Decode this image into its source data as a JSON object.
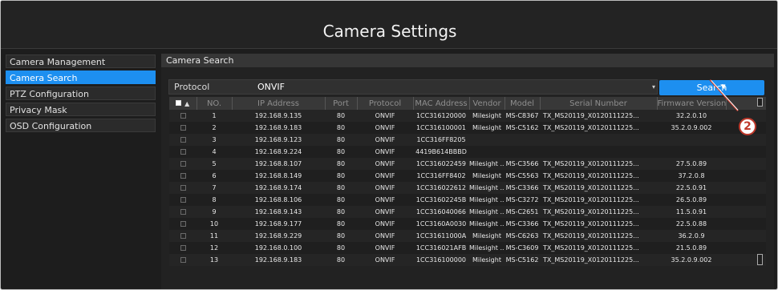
{
  "window": {
    "title": "Camera Settings"
  },
  "sidebar": {
    "items": [
      {
        "label": "Camera Management",
        "active": false
      },
      {
        "label": "Camera Search",
        "active": true
      },
      {
        "label": "PTZ Configuration",
        "active": false
      },
      {
        "label": "Privacy Mask",
        "active": false
      },
      {
        "label": "OSD Configuration",
        "active": false
      }
    ]
  },
  "main": {
    "header": "Camera Search",
    "protocol": {
      "label": "Protocol",
      "value": "ONVIF"
    },
    "search_label": "Search",
    "table": {
      "columns": [
        "NO.",
        "IP Address",
        "Port",
        "Protocol",
        "MAC Address",
        "Vendor",
        "Model",
        "Serial Number",
        "Firmware Version"
      ],
      "rows": [
        [
          "1",
          "192.168.9.135",
          "80",
          "ONVIF",
          "1CC316120000",
          "Milesight",
          "MS-C8367",
          "TX_MS20119_X0120111225...",
          "32.2.0.10"
        ],
        [
          "2",
          "192.168.9.183",
          "80",
          "ONVIF",
          "1CC316100001",
          "Milesight",
          "MS-C5162",
          "TX_MS20119_X0120111225...",
          "35.2.0.9.002"
        ],
        [
          "3",
          "192.168.9.123",
          "80",
          "ONVIF",
          "1CC316FF8205",
          "",
          "",
          "",
          ""
        ],
        [
          "4",
          "192.168.9.224",
          "80",
          "ONVIF",
          "4419B614BBBD",
          "",
          "",
          "",
          ""
        ],
        [
          "5",
          "192.168.8.107",
          "80",
          "ONVIF",
          "1CC316022459",
          "Milesight ...",
          "MS-C3566",
          "TX_MS20119_X0120111225...",
          "27.5.0.89"
        ],
        [
          "6",
          "192.168.8.149",
          "80",
          "ONVIF",
          "1CC316FF8402",
          "Milesight",
          "MS-C5563",
          "TX_MS20119_X0120111225...",
          "37.2.0.8"
        ],
        [
          "7",
          "192.168.9.174",
          "80",
          "ONVIF",
          "1CC316022612",
          "Milesight ...",
          "MS-C3366",
          "TX_MS20119_X0120111225...",
          "22.5.0.91"
        ],
        [
          "8",
          "192.168.8.106",
          "80",
          "ONVIF",
          "1CC31602245B",
          "Milesight ...",
          "MS-C3272",
          "TX_MS20119_X0120111225...",
          "26.5.0.89"
        ],
        [
          "9",
          "192.168.9.143",
          "80",
          "ONVIF",
          "1CC316040066",
          "Milesight ...",
          "MS-C2651",
          "TX_MS20119_X0120111225...",
          "11.5.0.91"
        ],
        [
          "10",
          "192.168.9.177",
          "80",
          "ONVIF",
          "1CC3160A0030",
          "Milesight ...",
          "MS-C3366",
          "TX_MS20119_X0120111225...",
          "22.5.0.88"
        ],
        [
          "11",
          "192.168.9.229",
          "80",
          "ONVIF",
          "1CC31611000A",
          "Milesight",
          "MS-C6263",
          "TX_MS20119_X0120111225...",
          "36.2.0.9"
        ],
        [
          "12",
          "192.168.0.100",
          "80",
          "ONVIF",
          "1CC316021AFB",
          "Milesight ...",
          "MS-C3609",
          "TX_MS20119_X0120111225...",
          "21.5.0.89"
        ],
        [
          "13",
          "192.168.9.183",
          "80",
          "ONVIF",
          "1CC316100000",
          "Milesight",
          "MS-C5162",
          "TX_MS20119_X0120111225...",
          "35.2.0.9.002"
        ]
      ]
    }
  },
  "callout": {
    "number": "2"
  },
  "colors": {
    "accent": "#1d8ff0",
    "background": "#1d1d1d",
    "callout": "#c0392b"
  }
}
